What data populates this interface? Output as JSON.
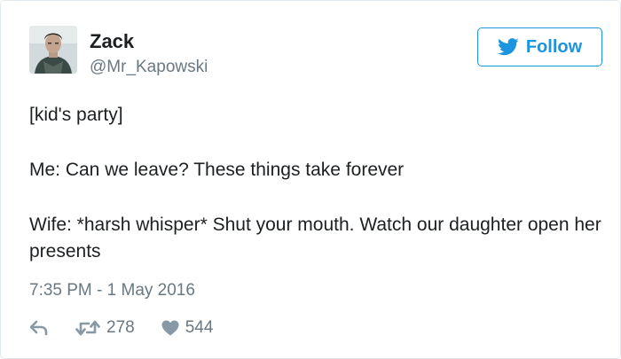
{
  "user": {
    "display_name": "Zack",
    "handle": "@Mr_Kapowski",
    "avatar_icon": "user-photo"
  },
  "follow": {
    "label": "Follow",
    "icon": "twitter-bird-icon",
    "accent_color": "#1b95e0"
  },
  "tweet": {
    "lines": [
      "[kid's party]",
      "Me: Can we leave? These things take forever",
      "Wife: *harsh whisper* Shut your mouth. Watch our daughter open her presents"
    ],
    "timestamp": "7:35 PM - 1 May 2016"
  },
  "actions": {
    "reply_icon": "reply-icon",
    "retweet_icon": "retweet-icon",
    "retweet_count": "278",
    "like_icon": "heart-icon",
    "like_count": "544"
  }
}
